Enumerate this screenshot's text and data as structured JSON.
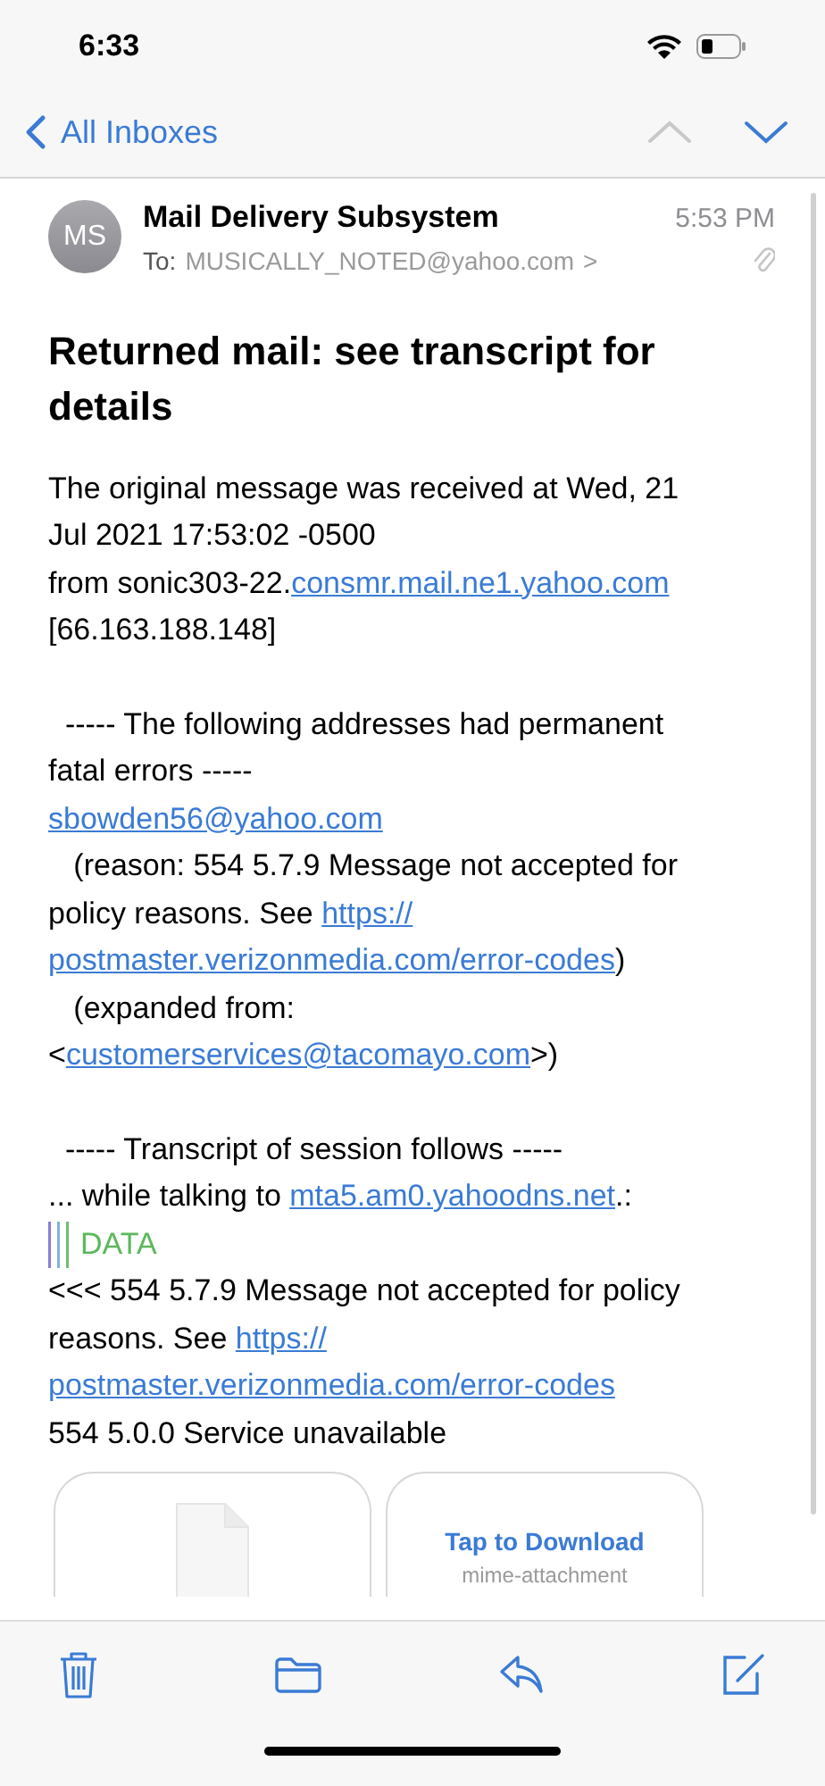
{
  "status_bar": {
    "time": "6:33"
  },
  "nav": {
    "back_label": "All Inboxes"
  },
  "header": {
    "avatar_initials": "MS",
    "sender": "Mail Delivery Subsystem",
    "time": "5:53 PM",
    "to_label": "To:",
    "to": "MUSICALLY_NOTED@yahoo.com",
    "chevron": ">"
  },
  "subject": "Returned mail: see transcript for details",
  "body": [
    {
      "lines": [
        {
          "kind": "line",
          "segments": [
            {
              "kind": "text",
              "text": "The original message was received at Wed, 21"
            }
          ]
        },
        {
          "kind": "line",
          "segments": [
            {
              "kind": "text",
              "text": "Jul 2021 17:53:02 -0500"
            }
          ]
        },
        {
          "kind": "line",
          "segments": [
            {
              "kind": "text",
              "text": "from sonic303-22."
            },
            {
              "kind": "link",
              "text": "consmr.mail.ne1.yahoo.com"
            }
          ]
        },
        {
          "kind": "line",
          "segments": [
            {
              "kind": "text",
              "text": "[66.163.188.148]"
            }
          ]
        }
      ]
    },
    {
      "lines": [
        {
          "kind": "line",
          "segments": [
            {
              "kind": "text",
              "text": "  ----- The following addresses had permanent"
            }
          ]
        },
        {
          "kind": "line",
          "segments": [
            {
              "kind": "text",
              "text": "fatal errors -----"
            }
          ]
        },
        {
          "kind": "line",
          "segments": [
            {
              "kind": "link",
              "text": "sbowden56@yahoo.com"
            }
          ]
        },
        {
          "kind": "line",
          "segments": [
            {
              "kind": "text",
              "text": "   (reason: 554 5.7.9 Message not accepted for"
            }
          ]
        },
        {
          "kind": "line",
          "segments": [
            {
              "kind": "text",
              "text": "policy reasons. See "
            },
            {
              "kind": "link",
              "text": "https://"
            }
          ]
        },
        {
          "kind": "line",
          "segments": [
            {
              "kind": "link",
              "text": "postmaster.verizonmedia.com/error-codes"
            },
            {
              "kind": "text",
              "text": ")"
            }
          ]
        },
        {
          "kind": "line",
          "segments": [
            {
              "kind": "text",
              "text": "   (expanded from:"
            }
          ]
        },
        {
          "kind": "line",
          "segments": [
            {
              "kind": "text",
              "text": "<"
            },
            {
              "kind": "link",
              "text": "customerservices@tacomayo.com"
            },
            {
              "kind": "text",
              "text": ">)"
            }
          ]
        }
      ]
    },
    {
      "lines": [
        {
          "kind": "line",
          "segments": [
            {
              "kind": "text",
              "text": "  ----- Transcript of session follows -----"
            }
          ]
        },
        {
          "kind": "line",
          "segments": [
            {
              "kind": "text",
              "text": "... while talking to "
            },
            {
              "kind": "link",
              "text": "mta5.am0.yahoodns.net"
            },
            {
              "kind": "text",
              "text": ".:"
            }
          ]
        },
        {
          "kind": "quote",
          "segments": [
            {
              "kind": "text",
              "text": "DATA"
            }
          ]
        },
        {
          "kind": "line",
          "segments": [
            {
              "kind": "text",
              "text": "<<< 554 5.7.9 Message not accepted for policy"
            }
          ]
        },
        {
          "kind": "line",
          "segments": [
            {
              "kind": "text",
              "text": "reasons. See "
            },
            {
              "kind": "link",
              "text": "https://"
            }
          ]
        },
        {
          "kind": "line",
          "segments": [
            {
              "kind": "link",
              "text": "postmaster.verizonmedia.com/error-codes"
            }
          ]
        },
        {
          "kind": "line",
          "segments": [
            {
              "kind": "text",
              "text": "554 5.0.0 Service unavailable"
            }
          ]
        }
      ]
    }
  ],
  "attachments": [
    {
      "kind": "file"
    },
    {
      "kind": "download",
      "action": "Tap to Download",
      "name": "mime-attachment"
    }
  ]
}
